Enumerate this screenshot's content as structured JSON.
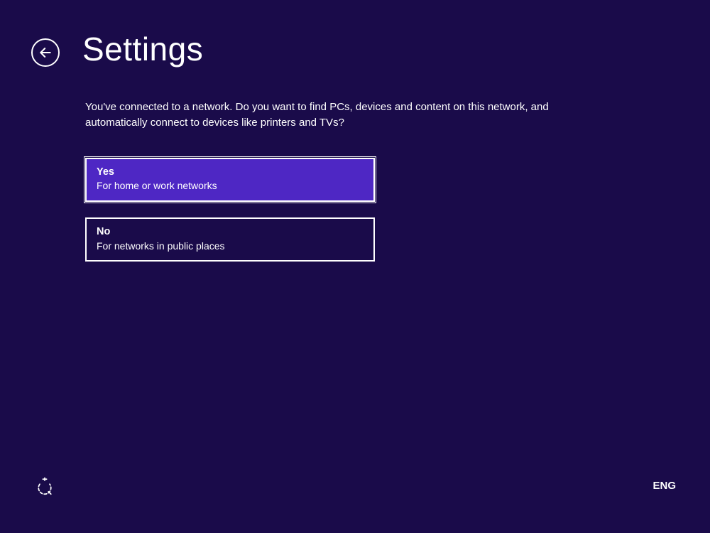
{
  "header": {
    "title": "Settings"
  },
  "prompt": "You've connected to a network. Do you want to find PCs, devices and content on this network, and automatically connect to devices like printers and TVs?",
  "options": {
    "yes": {
      "title": "Yes",
      "subtitle": "For home or work networks"
    },
    "no": {
      "title": "No",
      "subtitle": "For networks in public places"
    }
  },
  "footer": {
    "language": "ENG"
  }
}
